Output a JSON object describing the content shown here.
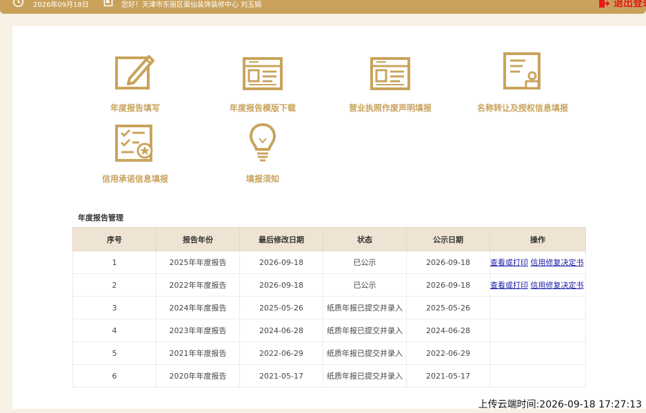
{
  "header": {
    "date": "2026年09月18日",
    "greeting": "您好！天津市东丽区蛋仙装饰装修中心  刘玉娟",
    "logout_label": "退出登录",
    "icons": {
      "clock": "clock-icon",
      "doc": "document-icon",
      "logout": "logout-icon"
    },
    "colors": {
      "bar": "#c9a15a",
      "logout": "#e8191a"
    }
  },
  "tiles": [
    {
      "label": "年度报告填写",
      "icon": "edit-form-icon"
    },
    {
      "label": "年度报告模版下载",
      "icon": "template-icon"
    },
    {
      "label": "营业执照作废声明填报",
      "icon": "license-void-icon"
    },
    {
      "label": "名称转让及授权信息填报",
      "icon": "stamp-document-icon"
    },
    {
      "label": "信用承诺信息填报",
      "icon": "checklist-badge-icon"
    },
    {
      "label": "填报须知",
      "icon": "lightbulb-icon"
    }
  ],
  "tile_color": "#c9a35c",
  "report_section": {
    "title": "年度报告管理",
    "columns": [
      "序号",
      "报告年份",
      "最后修改日期",
      "状态",
      "公示日期",
      "操作"
    ],
    "rows": [
      {
        "no": "1",
        "year": "2025年年度报告",
        "modified": "2026-09-18",
        "status": "已公示",
        "published": "2026-09-18",
        "actions": [
          "查看或打印",
          "信用修复决定书"
        ]
      },
      {
        "no": "2",
        "year": "2022年年度报告",
        "modified": "2026-09-18",
        "status": "已公示",
        "published": "2026-09-18",
        "actions": [
          "查看或打印",
          "信用修复决定书"
        ]
      },
      {
        "no": "3",
        "year": "2024年年度报告",
        "modified": "2025-05-26",
        "status": "纸质年报已提交并录入",
        "published": "2025-05-26",
        "actions": []
      },
      {
        "no": "4",
        "year": "2023年年度报告",
        "modified": "2024-06-28",
        "status": "纸质年报已提交并录入",
        "published": "2024-06-28",
        "actions": []
      },
      {
        "no": "5",
        "year": "2021年年度报告",
        "modified": "2022-06-29",
        "status": "纸质年报已提交并录入",
        "published": "2022-06-29",
        "actions": []
      },
      {
        "no": "6",
        "year": "2020年年度报告",
        "modified": "2021-05-17",
        "status": "纸质年报已提交并录入",
        "published": "2021-05-17",
        "actions": []
      }
    ]
  },
  "footer": {
    "upload_time": "上传云端时间:2026-09-18 17:27:13"
  }
}
